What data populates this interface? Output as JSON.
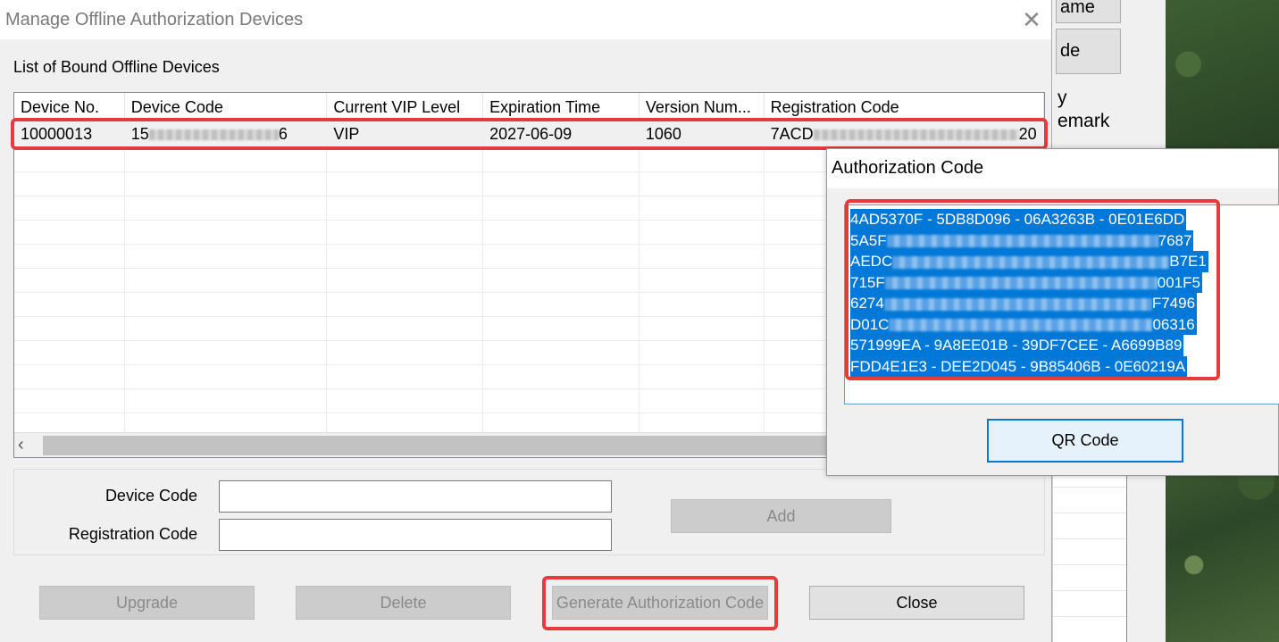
{
  "background": {
    "button_top_label": "ame",
    "button_mid_label": "de",
    "partial_text_1": "y",
    "partial_text_2": "emark"
  },
  "dialog": {
    "title": "Manage Offline Authorization Devices",
    "close_glyph": "✕",
    "list_label": "List of Bound Offline Devices",
    "columns": [
      "Device No.",
      "Device Code",
      "Current VIP Level",
      "Expiration Time",
      "Version Num...",
      "Registration Code"
    ],
    "rows": [
      {
        "device_no": "10000013",
        "device_code_start": "15",
        "device_code_end": "6",
        "vip_level": "VIP",
        "expiration": "2027-06-09",
        "version": "1060",
        "registration_start": "7ACD",
        "registration_end": "20"
      }
    ],
    "scroll_left_glyph": "‹",
    "form": {
      "device_code_label": "Device Code",
      "registration_code_label": "Registration Code",
      "device_code_value": "",
      "registration_code_value": "",
      "add_label": "Add"
    },
    "buttons": {
      "upgrade": "Upgrade",
      "delete": "Delete",
      "generate": "Generate Authorization Code",
      "close": "Close"
    }
  },
  "popup": {
    "title": "Authorization Code",
    "code_lines": [
      {
        "start": "4AD5370F - 5DB8D096 - 06A3263B - 0E01E6DD",
        "end": ""
      },
      {
        "start": "5A5F",
        "end": "7687"
      },
      {
        "start": "AEDC",
        "end": "B7E1"
      },
      {
        "start": "715F",
        "end": "001F5"
      },
      {
        "start": "6274",
        "end": "F7496"
      },
      {
        "start": "D01C",
        "end": "06316"
      },
      {
        "start": "571999EA - 9A8EE01B - 39DF7CEE - A6699B89",
        "end": ""
      },
      {
        "start": "FDD4E1E3 - DEE2D045 - 9B85406B - 0E60219A",
        "end": ""
      }
    ],
    "qr_button": "QR Code"
  },
  "colors": {
    "highlight_red": "#e83a3a",
    "selection_blue": "#0078d7"
  }
}
